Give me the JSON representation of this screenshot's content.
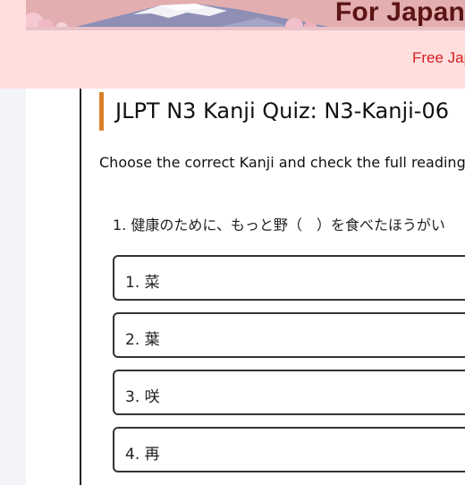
{
  "header": {
    "banner_title": "For Japan",
    "tagline": "Free Jap"
  },
  "quiz": {
    "title": "JLPT N3 Kanji Quiz: N3-Kanji-06",
    "instructions": "Choose the correct Kanji and check the full reading!",
    "question": "1. 健康のために、もっと野（　）を食べたほうがい",
    "options": [
      {
        "label": "1. 菜"
      },
      {
        "label": "2. 葉"
      },
      {
        "label": "3. 咲"
      },
      {
        "label": "4. 再"
      }
    ]
  },
  "colors": {
    "header_bg": "#ffdede",
    "title_accent": "#d9822b",
    "tagline": "#d31f1f",
    "banner_text": "#5b1414"
  },
  "icons": {
    "banner_art": "mount-fuji-illustration"
  }
}
